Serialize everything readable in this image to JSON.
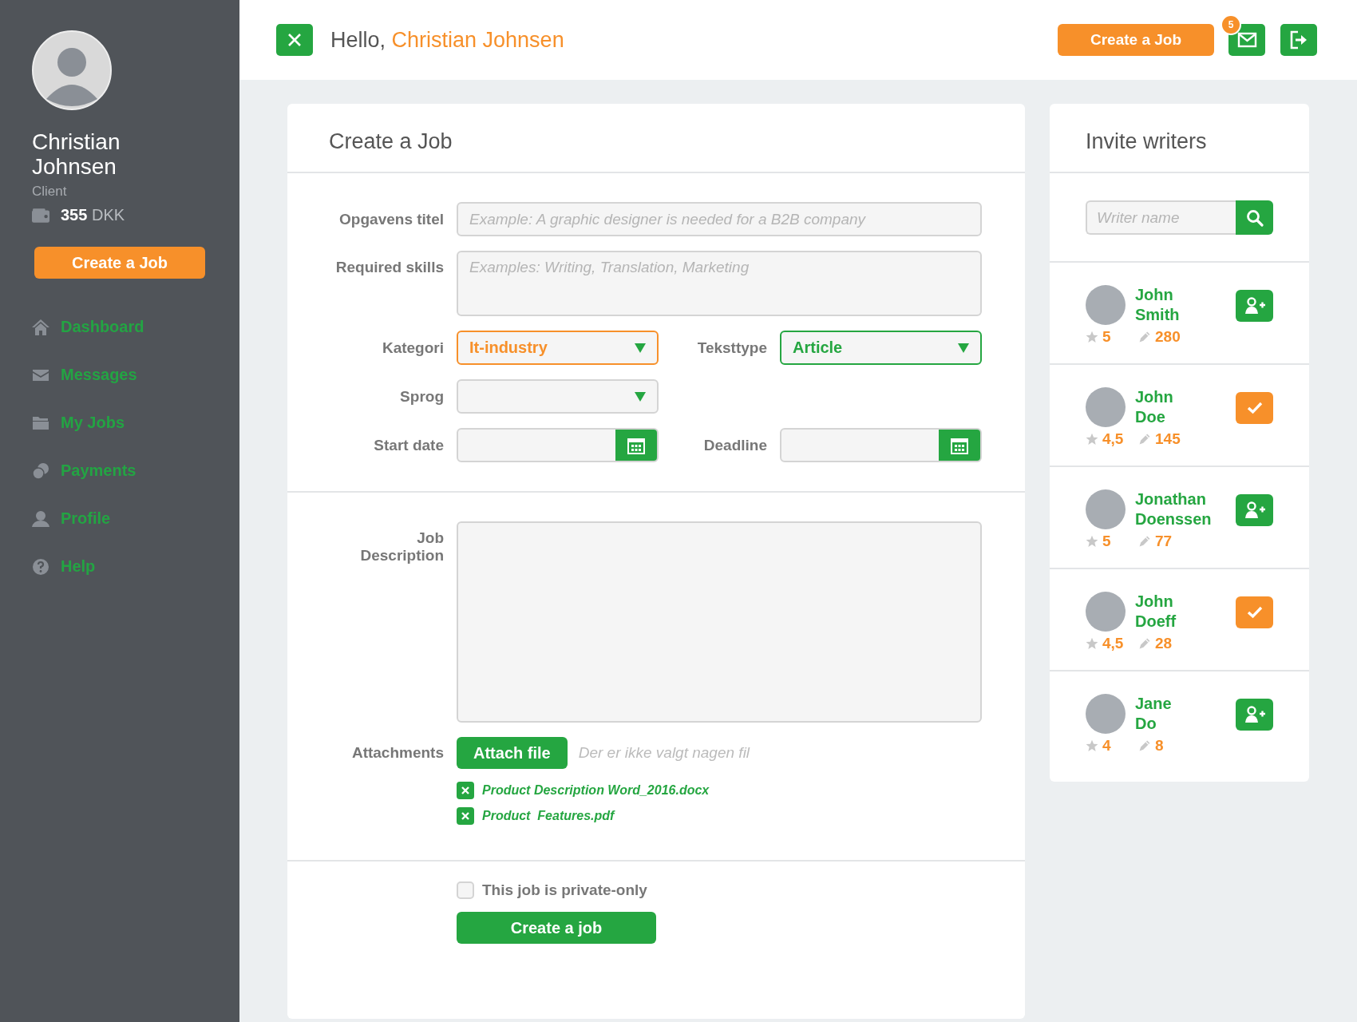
{
  "sidebar": {
    "name": "Christian Johnsen",
    "role": "Client",
    "balance_amount": "355",
    "balance_currency": "DKK",
    "create_button": "Create a Job",
    "nav": [
      {
        "label": "Dashboard",
        "kind": "home"
      },
      {
        "label": "Messages",
        "kind": "mail"
      },
      {
        "label": "My Jobs",
        "kind": "folder"
      },
      {
        "label": "Payments",
        "kind": "coins"
      },
      {
        "label": "Profile",
        "kind": "person"
      },
      {
        "label": "Help",
        "kind": "help"
      }
    ]
  },
  "header": {
    "greeting": "Hello,",
    "user_name": "Christian Johnsen",
    "create_button": "Create a Job",
    "messages_badge": "5"
  },
  "form": {
    "title": "Create a Job",
    "job_title": {
      "label": "Opgavens titel",
      "placeholder": "Example: A graphic designer is needed for a B2B company"
    },
    "skills": {
      "label": "Required skills",
      "placeholder": "Examples: Writing, Translation, Marketing"
    },
    "category": {
      "label": "Kategori",
      "value": "It-industry",
      "focused": true
    },
    "text_type": {
      "label": "Teksttype",
      "value": "Article",
      "focused": false
    },
    "language": {
      "label": "Sprog"
    },
    "start_date": {
      "label": "Start date"
    },
    "deadline": {
      "label": "Deadline"
    },
    "description": {
      "label": "Job Description"
    },
    "attachments": {
      "label": "Attachments",
      "button": "Attach file",
      "status": "Der er ikke valgt nagen fil",
      "files": [
        "Product Description Word_2016.docx",
        "Product  Features.pdf"
      ]
    },
    "private": {
      "label": "This job is private-only",
      "checked": false
    },
    "submit": "Create a job"
  },
  "writers": {
    "title": "Invite writers",
    "search_placeholder": "Writer name",
    "items": [
      {
        "name": "John Smith",
        "rating": "5",
        "jobs": "280",
        "invited": false
      },
      {
        "name": "John Doe",
        "rating": "4,5",
        "jobs": "145",
        "invited": true
      },
      {
        "name": "Jonathan Doenssen",
        "rating": "5",
        "jobs": "77",
        "invited": false
      },
      {
        "name": "John Doeff",
        "rating": "4,5",
        "jobs": "28",
        "invited": true
      },
      {
        "name": "Jane Do",
        "rating": "4",
        "jobs": "8",
        "invited": false
      }
    ]
  }
}
